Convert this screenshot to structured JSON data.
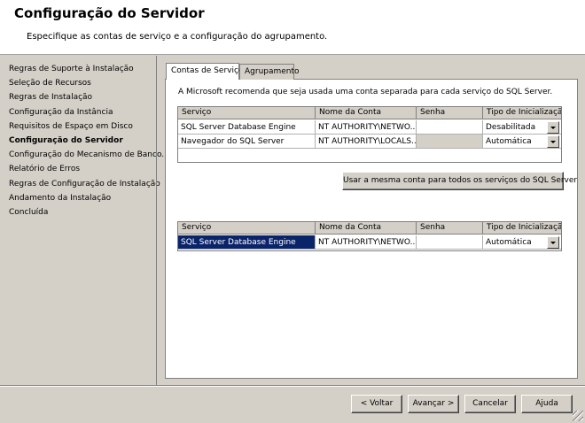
{
  "header": {
    "title": "Configuração do Servidor",
    "subtitle": "Especifique as contas de serviço e a configuração do agrupamento."
  },
  "sidebar": {
    "items": [
      {
        "label": "Regras de Suporte à Instalação",
        "active": false
      },
      {
        "label": "Seleção de Recursos",
        "active": false
      },
      {
        "label": "Regras de Instalação",
        "active": false
      },
      {
        "label": "Configuração da Instância",
        "active": false
      },
      {
        "label": "Requisitos de Espaço em Disco",
        "active": false
      },
      {
        "label": "Configuração do Servidor",
        "active": true
      },
      {
        "label": "Configuração do Mecanismo de Banco...",
        "active": false
      },
      {
        "label": "Relatório de Erros",
        "active": false
      },
      {
        "label": "Regras de Configuração de Instalação",
        "active": false
      },
      {
        "label": "Andamento da Instalação",
        "active": false
      },
      {
        "label": "Concluída",
        "active": false
      }
    ]
  },
  "tabs": [
    {
      "label": "Contas de Serviço",
      "active": true
    },
    {
      "label": "Agrupamento",
      "active": false
    }
  ],
  "note": "A Microsoft recomenda que seja usada uma conta separada para cada serviço do SQL Server.",
  "columns": [
    "Serviço",
    "Nome da Conta",
    "Senha",
    "Tipo de Inicialização"
  ],
  "grid1": {
    "rows": [
      {
        "service": "SQL Server Database Engine",
        "account": "NT AUTHORITY\\NETWO...",
        "password": "",
        "startup": "Desabilitada"
      },
      {
        "service": "Navegador do SQL Server",
        "account": "NT AUTHORITY\\LOCALS...",
        "password": "",
        "startup": "Automática"
      }
    ]
  },
  "same_account_button": "Usar a mesma conta para todos os serviços do SQL Server",
  "grid2": {
    "rows": [
      {
        "service": "SQL Server Database Engine",
        "account": "NT AUTHORITY\\NETWO...",
        "password": "",
        "startup": "Automática"
      }
    ]
  },
  "footer": {
    "back": "< Voltar",
    "next": "Avançar >",
    "cancel": "Cancelar",
    "help": "Ajuda"
  },
  "colors": {
    "selection": "#0a246a",
    "dialog_bg": "#d4d0c8"
  }
}
